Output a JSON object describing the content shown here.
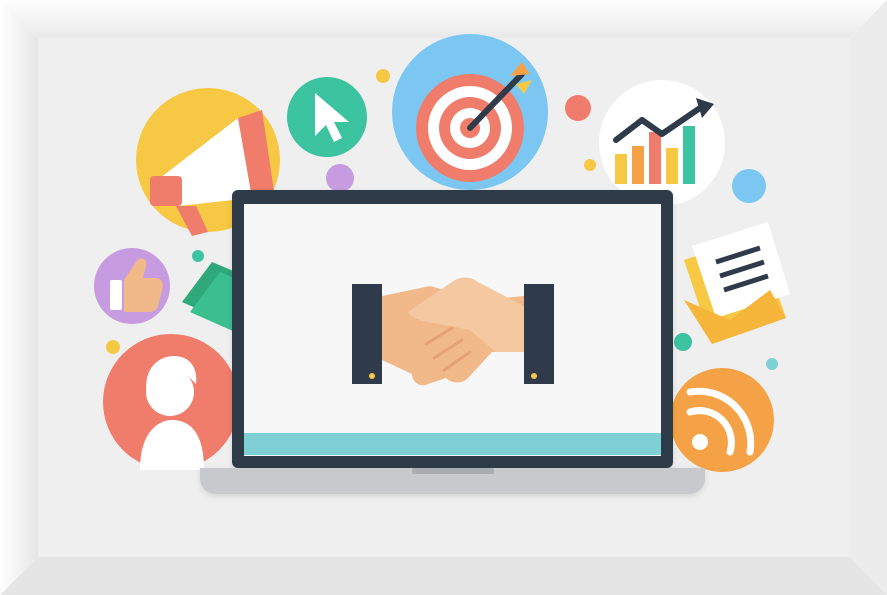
{
  "illustration": {
    "subject": "handshake-on-laptop",
    "icons": [
      "megaphone-icon",
      "cursor-icon",
      "target-icon",
      "growth-chart-icon",
      "thumbs-up-icon",
      "money-icon",
      "email-icon",
      "user-avatar-icon",
      "rss-icon"
    ]
  },
  "colors": {
    "frame_background": "#efefef",
    "laptop_body": "#2f3a4a",
    "laptop_screen": "#f7f7f7",
    "screen_bar": "#7fd0d4",
    "yellow": "#f6c843",
    "teal": "#3cc3a0",
    "blue_light": "#7cc7f2",
    "coral": "#f07c6b",
    "orange": "#f5a246",
    "purple": "#c79be0",
    "skin": "#f1b98a",
    "green_money": "#3cbf8e"
  }
}
